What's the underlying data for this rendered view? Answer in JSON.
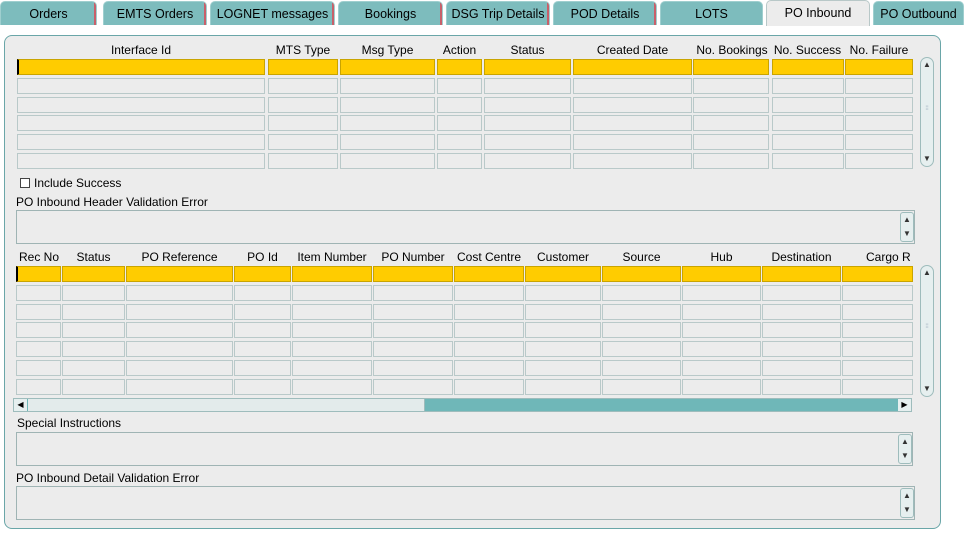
{
  "tabs": [
    {
      "label": "Orders",
      "active": false
    },
    {
      "label": "EMTS Orders",
      "active": false
    },
    {
      "label": "LOGNET messages",
      "active": false
    },
    {
      "label": "Bookings",
      "active": false
    },
    {
      "label": "DSG Trip Details",
      "active": false
    },
    {
      "label": "POD Details",
      "active": false
    },
    {
      "label": "LOTS",
      "active": false
    },
    {
      "label": "PO Inbound",
      "active": true
    },
    {
      "label": "PO Outbound",
      "active": false
    }
  ],
  "header_table": {
    "columns": [
      "Interface Id",
      "MTS Type",
      "Msg Type",
      "Action",
      "Status",
      "Created Date",
      "No. Bookings",
      "No. Success",
      "No. Failure"
    ],
    "row_count": 6
  },
  "include_success": {
    "label": "Include Success",
    "checked": false
  },
  "header_error": {
    "label": "PO Inbound Header Validation Error",
    "value": ""
  },
  "detail_table": {
    "columns": [
      "Rec No",
      "Status",
      "PO Reference",
      "PO Id",
      "Item Number",
      "PO Number",
      "Cost Centre",
      "Customer",
      "Source",
      "Hub",
      "Destination",
      "Cargo R"
    ],
    "row_count": 7
  },
  "special_instructions": {
    "label": "Special Instructions",
    "value": ""
  },
  "detail_error": {
    "label": "PO Inbound Detail Validation Error",
    "value": ""
  },
  "colors": {
    "accent": "#7dbcbd",
    "selected_row": "#ffcc00",
    "panel": "#ececec"
  },
  "icons": [
    "scroll-up-icon",
    "scroll-down-icon",
    "scroll-left-icon",
    "scroll-right-icon",
    "scroll-grip-icon"
  ]
}
